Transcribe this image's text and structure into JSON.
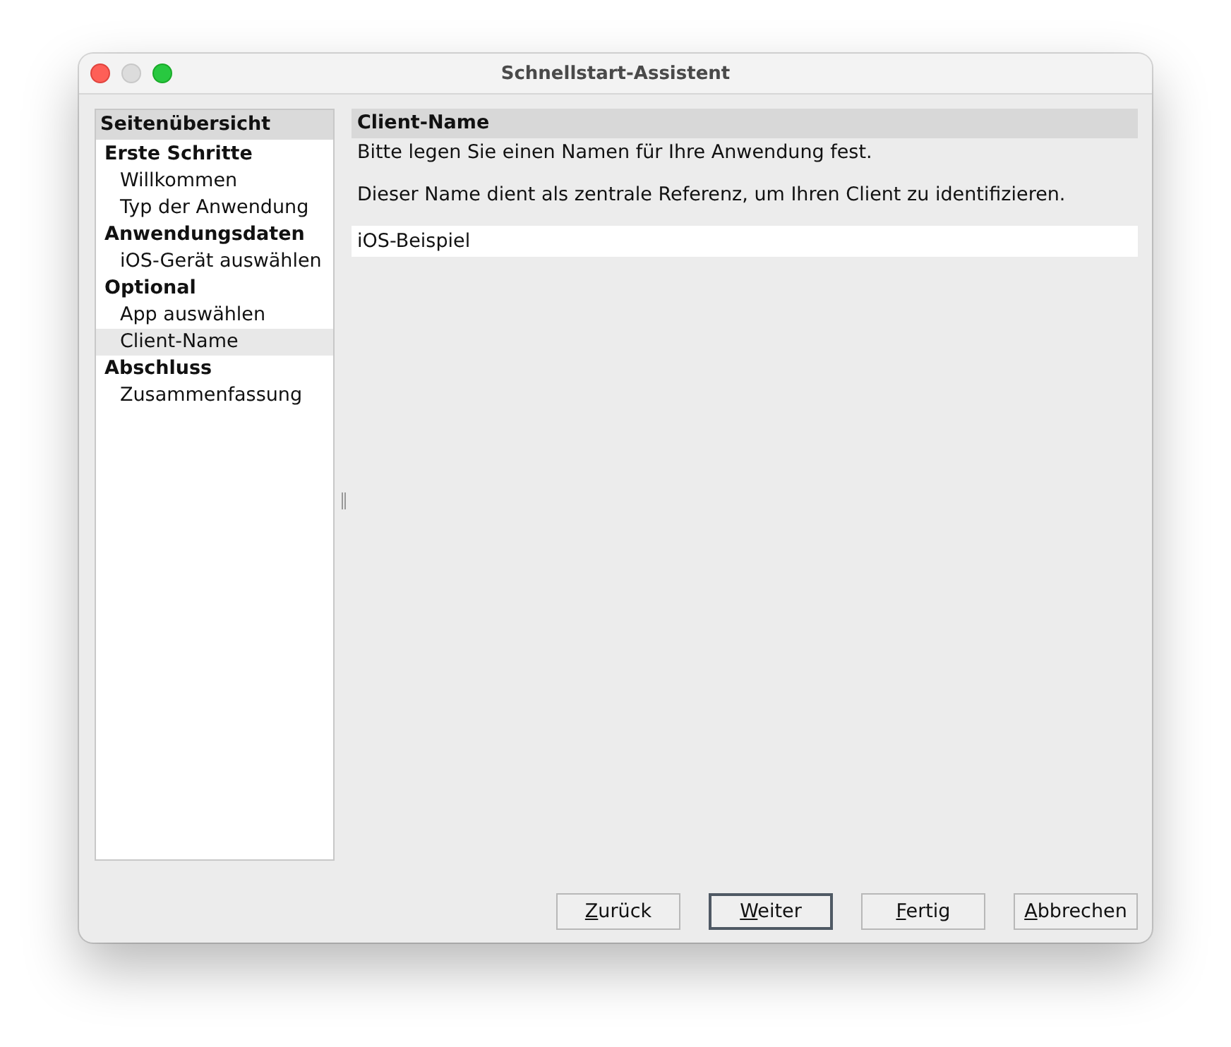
{
  "window": {
    "title": "Schnellstart-Assistent"
  },
  "sidebar": {
    "title": "Seitenübersicht",
    "groups": [
      {
        "label": "Erste Schritte",
        "children": [
          {
            "label": "Willkommen",
            "selected": false
          },
          {
            "label": "Typ der Anwendung",
            "selected": false
          }
        ]
      },
      {
        "label": "Anwendungsdaten",
        "children": [
          {
            "label": "iOS-Gerät auswählen",
            "selected": false
          }
        ]
      },
      {
        "label": "Optional",
        "children": [
          {
            "label": "App auswählen",
            "selected": false
          },
          {
            "label": "Client-Name",
            "selected": true
          }
        ]
      },
      {
        "label": "Abschluss",
        "children": [
          {
            "label": "Zusammenfassung",
            "selected": false
          }
        ]
      }
    ]
  },
  "page": {
    "title": "Client-Name",
    "paragraphs": [
      "Bitte legen Sie einen Namen für Ihre Anwendung fest.",
      "Dieser Name dient als zentrale Referenz, um Ihren Client zu identifizieren."
    ],
    "field": {
      "value": "iOS-Beispiel"
    }
  },
  "buttons": [
    {
      "label": "Zurück",
      "mnemonic": true,
      "default": false
    },
    {
      "label": "Weiter",
      "mnemonic": true,
      "default": true
    },
    {
      "label": "Fertig",
      "mnemonic": true,
      "default": false
    },
    {
      "label": "Abbrechen",
      "mnemonic": true,
      "default": false
    }
  ]
}
